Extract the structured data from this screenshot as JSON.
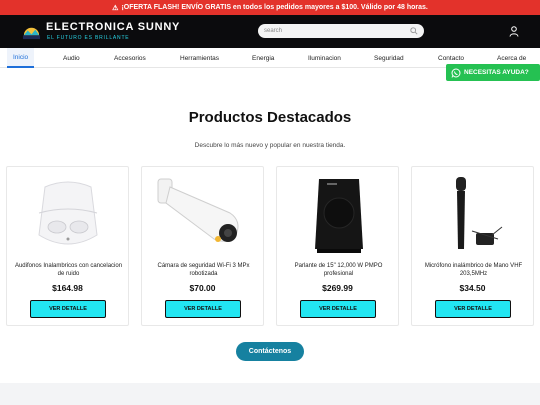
{
  "flash": {
    "icon": "warning-icon",
    "text": "¡OFERTA FLASH! ENVÍO GRATIS en todos los pedidos mayores a $100. Válido por 48 horas."
  },
  "header": {
    "brand": "ELECTRONICA SUNNY",
    "tagline": "EL FUTURO ES BRILLANTE",
    "search_placeholder": "search",
    "accent": "#29d4e6"
  },
  "nav": {
    "items": [
      {
        "label": "Inicio"
      },
      {
        "label": "Audio"
      },
      {
        "label": "Accesorios"
      },
      {
        "label": "Herramientas"
      },
      {
        "label": "Energia"
      },
      {
        "label": "Iluminacion"
      },
      {
        "label": "Seguridad"
      },
      {
        "label": "Contacto"
      },
      {
        "label": "Acerca de"
      }
    ]
  },
  "whatsapp": {
    "label": "NECESITAS AYUDA?",
    "color": "#25c152"
  },
  "main": {
    "title": "Productos Destacados",
    "subtitle": "Descubre lo más nuevo y popular en nuestra tienda.",
    "products": [
      {
        "name": "Audifonos Inalambricos con cancelacion de ruido",
        "price": "$164.98",
        "button": "VER DETALLE",
        "image": "earbuds-image"
      },
      {
        "name": "Cámara de seguridad Wi-Fi 3 MPx robotizada",
        "price": "$70.00",
        "button": "VER DETALLE",
        "image": "camera-image"
      },
      {
        "name": "Parlante de 15\" 12,000 W PMPO profesional",
        "price": "$269.99",
        "button": "VER DETALLE",
        "image": "speaker-image"
      },
      {
        "name": "Micrófono inalámbrico de Mano VHF 203,5MHz",
        "price": "$34.50",
        "button": "VER DETALLE",
        "image": "microphone-image"
      }
    ],
    "contact_label": "Contáctenos"
  }
}
